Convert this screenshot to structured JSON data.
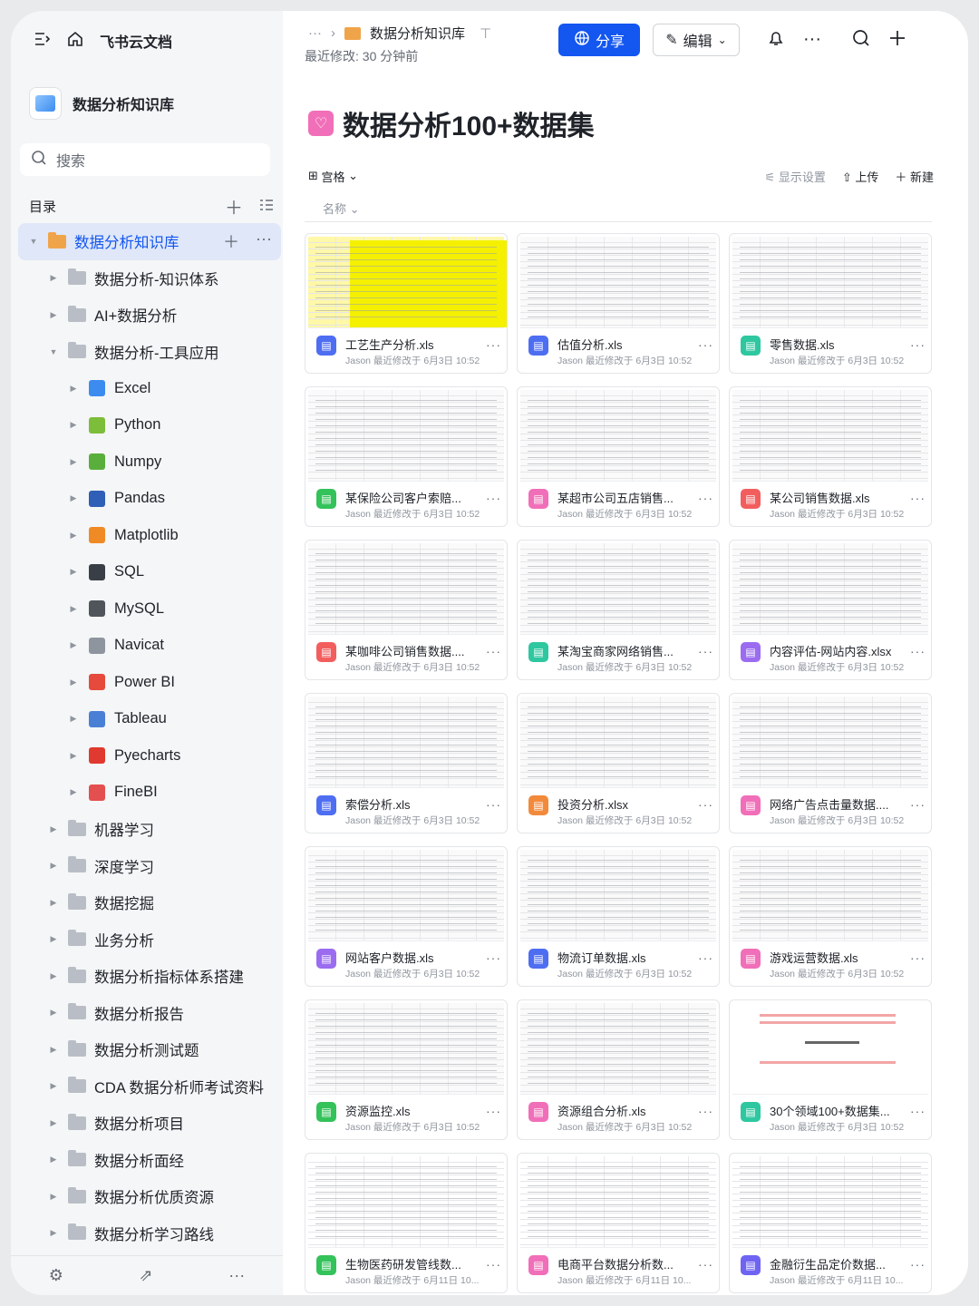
{
  "app": {
    "title": "飞书云文档"
  },
  "sidebar": {
    "kb_title": "数据分析知识库",
    "search_label": "搜索",
    "toc_label": "目录",
    "tree": [
      {
        "label": "数据分析知识库",
        "level": 0,
        "expanded": true,
        "active": true,
        "icon": "folder-orange-icon"
      },
      {
        "label": "数据分析-知识体系",
        "level": 1,
        "expanded": false,
        "icon": "folder-icon"
      },
      {
        "label": "AI+数据分析",
        "level": 1,
        "expanded": false,
        "icon": "folder-icon"
      },
      {
        "label": "数据分析-工具应用",
        "level": 1,
        "expanded": true,
        "icon": "folder-icon"
      },
      {
        "label": "Excel",
        "level": 2,
        "expanded": false,
        "icon": "excel-icon",
        "color": "#3c8cf0"
      },
      {
        "label": "Python",
        "level": 2,
        "expanded": false,
        "icon": "python-icon",
        "color": "#7cbd3a"
      },
      {
        "label": "Numpy",
        "level": 2,
        "expanded": false,
        "icon": "numpy-icon",
        "color": "#5aaf3c"
      },
      {
        "label": "Pandas",
        "level": 2,
        "expanded": false,
        "icon": "pandas-icon",
        "color": "#2f5fb6"
      },
      {
        "label": "Matplotlib",
        "level": 2,
        "expanded": false,
        "icon": "matplotlib-icon",
        "color": "#f08a24"
      },
      {
        "label": "SQL",
        "level": 2,
        "expanded": false,
        "icon": "sql-icon",
        "color": "#3a3f47"
      },
      {
        "label": "MySQL",
        "level": 2,
        "expanded": false,
        "icon": "mysql-icon",
        "color": "#50555c"
      },
      {
        "label": "Navicat",
        "level": 2,
        "expanded": false,
        "icon": "navicat-icon",
        "color": "#8f959e"
      },
      {
        "label": "Power BI",
        "level": 2,
        "expanded": false,
        "icon": "powerbi-icon",
        "color": "#e64a3c"
      },
      {
        "label": "Tableau",
        "level": 2,
        "expanded": false,
        "icon": "tableau-icon",
        "color": "#4a7fd6"
      },
      {
        "label": "Pyecharts",
        "level": 2,
        "expanded": false,
        "icon": "pyecharts-icon",
        "color": "#e0392f"
      },
      {
        "label": "FineBI",
        "level": 2,
        "expanded": false,
        "icon": "finebi-calendar-icon",
        "color": "#e44f4f"
      },
      {
        "label": "机器学习",
        "level": 1,
        "expanded": false,
        "icon": "folder-icon"
      },
      {
        "label": "深度学习",
        "level": 1,
        "expanded": false,
        "icon": "folder-icon"
      },
      {
        "label": "数据挖掘",
        "level": 1,
        "expanded": false,
        "icon": "folder-icon"
      },
      {
        "label": "业务分析",
        "level": 1,
        "expanded": false,
        "icon": "folder-icon"
      },
      {
        "label": "数据分析指标体系搭建",
        "level": 1,
        "expanded": false,
        "icon": "folder-icon"
      },
      {
        "label": "数据分析报告",
        "level": 1,
        "expanded": false,
        "icon": "folder-icon"
      },
      {
        "label": "数据分析测试题",
        "level": 1,
        "expanded": false,
        "icon": "folder-icon"
      },
      {
        "label": "CDA 数据分析师考试资料",
        "level": 1,
        "expanded": false,
        "icon": "folder-icon"
      },
      {
        "label": "数据分析项目",
        "level": 1,
        "expanded": false,
        "icon": "folder-icon"
      },
      {
        "label": "数据分析面经",
        "level": 1,
        "expanded": false,
        "icon": "folder-icon"
      },
      {
        "label": "数据分析优质资源",
        "level": 1,
        "expanded": false,
        "icon": "folder-icon"
      },
      {
        "label": "数据分析学习路线",
        "level": 1,
        "expanded": false,
        "icon": "folder-icon"
      }
    ]
  },
  "header": {
    "breadcrumb_dots": "···",
    "breadcrumb_title": "数据分析知识库",
    "last_modified": "最近修改: 30 分钟前",
    "share_label": "分享",
    "edit_label": "编辑"
  },
  "doc": {
    "title": "数据分析100+数据集",
    "view_label": "宫格",
    "display_settings": "显示设置",
    "upload_label": "上传",
    "new_label": "新建",
    "sort_label": "名称"
  },
  "files": [
    {
      "name": "工艺生产分析.xls",
      "sub": "Jason 最近修改于 6月3日 10:52",
      "color": "#4e6ef2",
      "thumb": "yellow"
    },
    {
      "name": "估值分析.xls",
      "sub": "Jason 最近修改于 6月3日 10:52",
      "color": "#4e6ef2",
      "thumb": "table"
    },
    {
      "name": "零售数据.xls",
      "sub": "Jason 最近修改于 6月3日 10:52",
      "color": "#2ec7a0",
      "thumb": "table"
    },
    {
      "name": "某保险公司客户索赔...",
      "sub": "Jason 最近修改于 6月3日 10:52",
      "color": "#34c25a",
      "thumb": "table"
    },
    {
      "name": "某超市公司五店销售...",
      "sub": "Jason 最近修改于 6月3日 10:52",
      "color": "#f06fb8",
      "thumb": "table"
    },
    {
      "name": "某公司销售数据.xls",
      "sub": "Jason 最近修改于 6月3日 10:52",
      "color": "#f25e5e",
      "thumb": "table"
    },
    {
      "name": "某咖啡公司销售数据....",
      "sub": "Jason 最近修改于 6月3日 10:52",
      "color": "#f25e5e",
      "thumb": "table"
    },
    {
      "name": "某淘宝商家网络销售...",
      "sub": "Jason 最近修改于 6月3日 10:52",
      "color": "#2ec7a0",
      "thumb": "table"
    },
    {
      "name": "内容评估-网站内容.xlsx",
      "sub": "Jason 最近修改于 6月3日 10:52",
      "color": "#9b6cf0",
      "thumb": "table"
    },
    {
      "name": "索偿分析.xls",
      "sub": "Jason 最近修改于 6月3日 10:52",
      "color": "#4e6ef2",
      "thumb": "table"
    },
    {
      "name": "投资分析.xlsx",
      "sub": "Jason 最近修改于 6月3日 10:52",
      "color": "#f28a3c",
      "thumb": "table"
    },
    {
      "name": "网络广告点击量数据....",
      "sub": "Jason 最近修改于 6月3日 10:52",
      "color": "#f06fb8",
      "thumb": "table"
    },
    {
      "name": "网站客户数据.xls",
      "sub": "Jason 最近修改于 6月3日 10:52",
      "color": "#9b6cf0",
      "thumb": "table"
    },
    {
      "name": "物流订单数据.xls",
      "sub": "Jason 最近修改于 6月3日 10:52",
      "color": "#4e6ef2",
      "thumb": "table"
    },
    {
      "name": "游戏运营数据.xls",
      "sub": "Jason 最近修改于 6月3日 10:52",
      "color": "#f06fb8",
      "thumb": "table"
    },
    {
      "name": "资源监控.xls",
      "sub": "Jason 最近修改于 6月3日 10:52",
      "color": "#34c25a",
      "thumb": "table"
    },
    {
      "name": "资源组合分析.xls",
      "sub": "Jason 最近修改于 6月3日 10:52",
      "color": "#f06fb8",
      "thumb": "table"
    },
    {
      "name": "30个领域100+数据集...",
      "sub": "Jason 最近修改于 6月3日 10:52",
      "color": "#2ec7a0",
      "thumb": "ppt"
    },
    {
      "name": "生物医药研发管线数...",
      "sub": "Jason 最近修改于 6月11日 10...",
      "color": "#34c25a",
      "thumb": "app"
    },
    {
      "name": "电商平台数据分析数...",
      "sub": "Jason 最近修改于 6月11日 10...",
      "color": "#f06fb8",
      "thumb": "app"
    },
    {
      "name": "金融衍生品定价数据...",
      "sub": "Jason 最近修改于 6月11日 10...",
      "color": "#6f64f2",
      "thumb": "app"
    }
  ],
  "colors": {
    "accent": "#1456f0",
    "active_bg": "#dfe7f8",
    "folder": "#b9bec6"
  }
}
